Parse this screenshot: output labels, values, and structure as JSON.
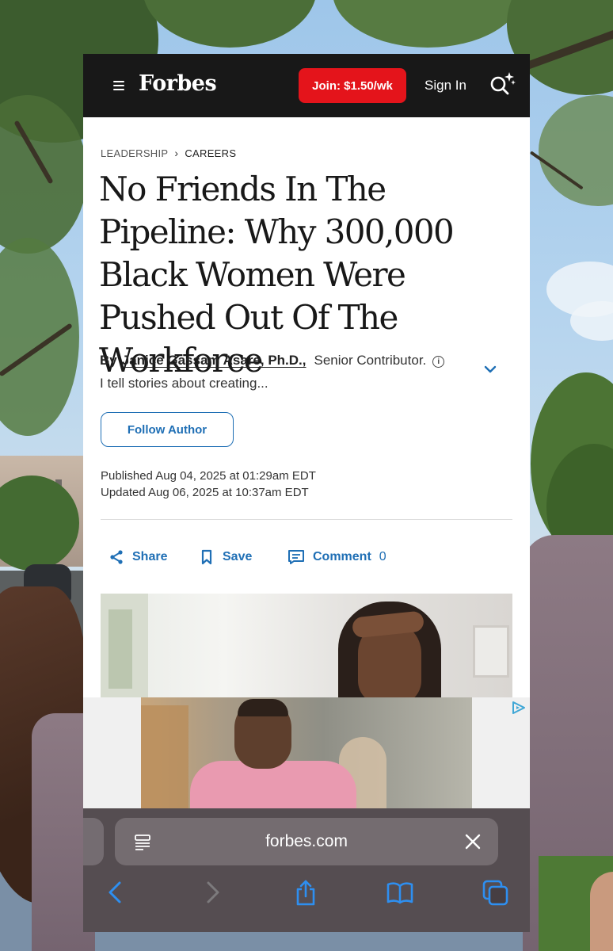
{
  "header": {
    "logo": "Forbes",
    "join_label": "Join: $1.50/wk",
    "signin_label": "Sign In"
  },
  "breadcrumb": {
    "section": "LEADERSHIP",
    "subsection": "CAREERS"
  },
  "article": {
    "headline": "No Friends In The Pipeline: Why 300,000 Black Women Were Pushed Out Of The Workforce",
    "by_prefix": "By",
    "author": "Janice Gassam Asare, Ph.D.,",
    "author_role": "Senior Contributor.",
    "author_tagline": "I tell stories about creating...",
    "follow_label": "Follow Author",
    "published": "Published Aug 04, 2025 at 01:29am EDT",
    "updated": "Updated Aug 06, 2025 at 10:37am EDT"
  },
  "actions": {
    "share": "Share",
    "save": "Save",
    "comment": "Comment",
    "comment_count": "0"
  },
  "browser": {
    "domain": "forbes.com"
  },
  "icons": [
    "menu-icon",
    "search-sparkle-icon",
    "chevron-right-icon",
    "info-icon",
    "chevron-down-icon",
    "share-icon",
    "bookmark-icon",
    "comment-icon",
    "ad-choices-icon",
    "reader-icon",
    "close-icon",
    "back-icon",
    "forward-icon",
    "share-sheet-icon",
    "bookmarks-icon",
    "tabs-icon"
  ],
  "colors": {
    "brand_black": "#181818",
    "join_red": "#e4141b",
    "link_blue": "#1f6fb5",
    "safari_blue": "#2e8ff0"
  }
}
